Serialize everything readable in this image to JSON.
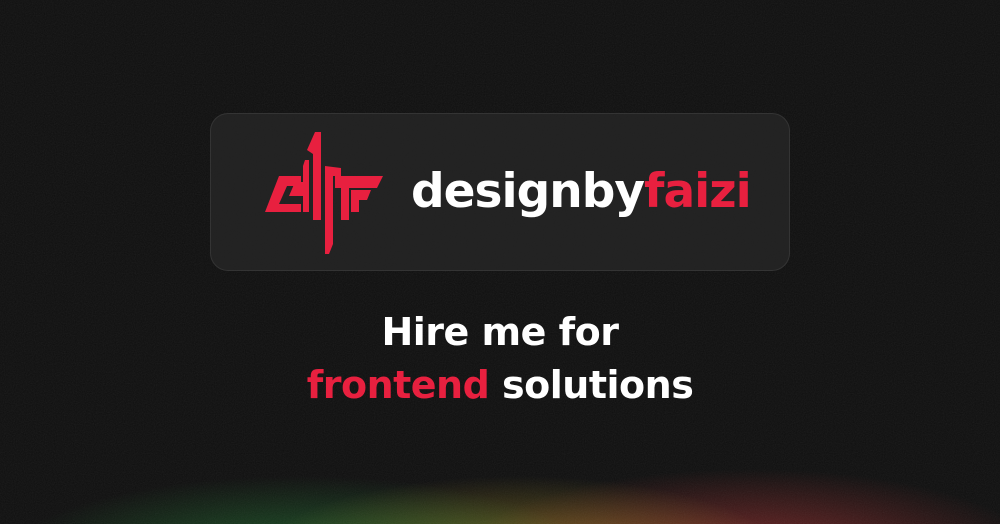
{
  "brand": {
    "name_part1": "designby",
    "name_part2": "faizi",
    "logo_icon": "df-monogram-icon",
    "accent_color": "#e8203f"
  },
  "headline": {
    "line1": "Hire me for",
    "line2_accent": "frontend",
    "line2_rest": " solutions"
  },
  "colors": {
    "background": "#0f0f0f",
    "card": "#262626",
    "text": "#ffffff",
    "accent": "#e8203f"
  }
}
